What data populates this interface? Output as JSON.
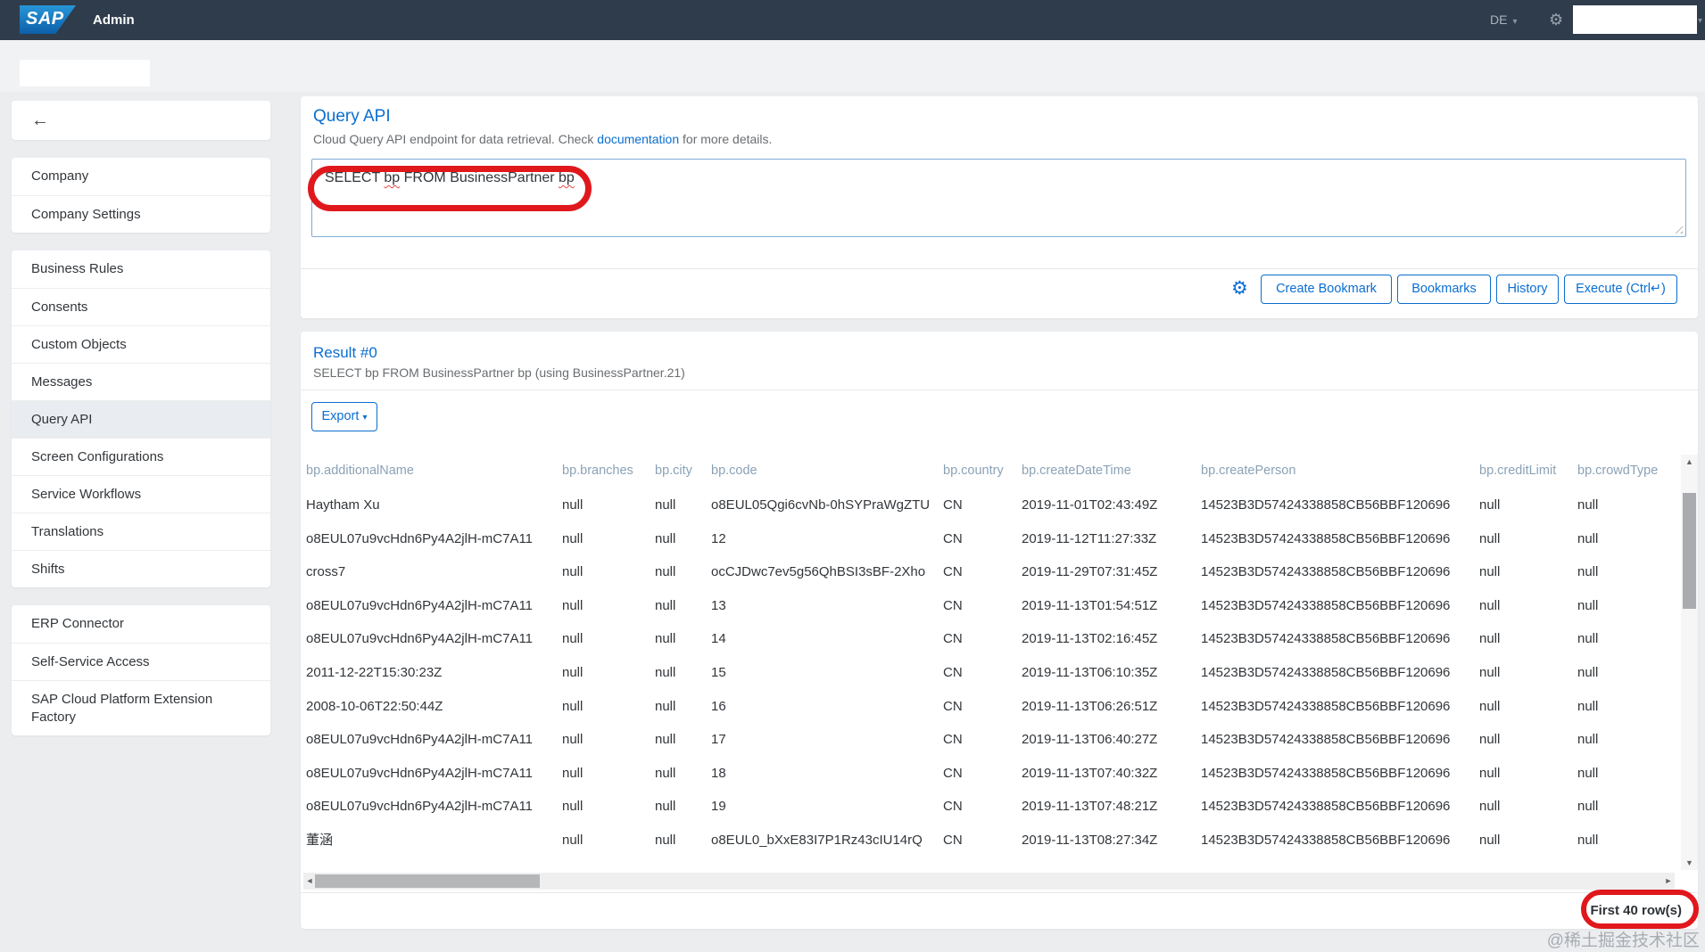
{
  "topbar": {
    "logo_text": "SAP",
    "app_title": "Admin",
    "language": "DE"
  },
  "sidebar": {
    "groups": [
      {
        "items": [
          {
            "label": "Company"
          },
          {
            "label": "Company Settings"
          }
        ]
      },
      {
        "items": [
          {
            "label": "Business Rules"
          },
          {
            "label": "Consents"
          },
          {
            "label": "Custom Objects"
          },
          {
            "label": "Messages"
          },
          {
            "label": "Query API"
          },
          {
            "label": "Screen Configurations"
          },
          {
            "label": "Service Workflows"
          },
          {
            "label": "Translations"
          },
          {
            "label": "Shifts"
          }
        ]
      },
      {
        "items": [
          {
            "label": "ERP Connector"
          },
          {
            "label": "Self-Service Access"
          },
          {
            "label": "SAP Cloud Platform Extension Factory"
          }
        ]
      }
    ]
  },
  "query_panel": {
    "title": "Query API",
    "subtitle_pre": "Cloud Query API endpoint for data retrieval. Check ",
    "subtitle_link": "documentation",
    "subtitle_post": " for more details.",
    "query": {
      "t1": "SELECT ",
      "t2": "bp",
      "t3": " FROM BusinessPartner ",
      "t4": "bp"
    },
    "buttons": {
      "create_bookmark": "Create Bookmark",
      "bookmarks": "Bookmarks",
      "history": "History",
      "execute": "Execute (Ctrl↵)"
    }
  },
  "result_panel": {
    "title": "Result #0",
    "subtitle": "SELECT bp FROM BusinessPartner bp (using BusinessPartner.21)",
    "export_label": "Export",
    "footer": "First 40 row(s)",
    "table": {
      "columns": [
        "bp.additionalName",
        "bp.branches",
        "bp.city",
        "bp.code",
        "bp.country",
        "bp.createDateTime",
        "bp.createPerson",
        "bp.creditLimit",
        "bp.crowdType"
      ],
      "rows": [
        [
          "Haytham Xu",
          "null",
          "null",
          "o8EUL05Qgi6cvNb-0hSYPraWgZTU",
          "CN",
          "2019-11-01T02:43:49Z",
          "14523B3D57424338858CB56BBF120696",
          "null",
          "null"
        ],
        [
          "o8EUL07u9vcHdn6Py4A2jlH-mC7A11",
          "null",
          "null",
          "12",
          "CN",
          "2019-11-12T11:27:33Z",
          "14523B3D57424338858CB56BBF120696",
          "null",
          "null"
        ],
        [
          "cross7",
          "null",
          "null",
          "ocCJDwc7ev5g56QhBSI3sBF-2Xho",
          "CN",
          "2019-11-29T07:31:45Z",
          "14523B3D57424338858CB56BBF120696",
          "null",
          "null"
        ],
        [
          "o8EUL07u9vcHdn6Py4A2jlH-mC7A11",
          "null",
          "null",
          "13",
          "CN",
          "2019-11-13T01:54:51Z",
          "14523B3D57424338858CB56BBF120696",
          "null",
          "null"
        ],
        [
          "o8EUL07u9vcHdn6Py4A2jlH-mC7A11",
          "null",
          "null",
          "14",
          "CN",
          "2019-11-13T02:16:45Z",
          "14523B3D57424338858CB56BBF120696",
          "null",
          "null"
        ],
        [
          "2011-12-22T15:30:23Z",
          "null",
          "null",
          "15",
          "CN",
          "2019-11-13T06:10:35Z",
          "14523B3D57424338858CB56BBF120696",
          "null",
          "null"
        ],
        [
          "2008-10-06T22:50:44Z",
          "null",
          "null",
          "16",
          "CN",
          "2019-11-13T06:26:51Z",
          "14523B3D57424338858CB56BBF120696",
          "null",
          "null"
        ],
        [
          "o8EUL07u9vcHdn6Py4A2jlH-mC7A11",
          "null",
          "null",
          "17",
          "CN",
          "2019-11-13T06:40:27Z",
          "14523B3D57424338858CB56BBF120696",
          "null",
          "null"
        ],
        [
          "o8EUL07u9vcHdn6Py4A2jlH-mC7A11",
          "null",
          "null",
          "18",
          "CN",
          "2019-11-13T07:40:32Z",
          "14523B3D57424338858CB56BBF120696",
          "null",
          "null"
        ],
        [
          "o8EUL07u9vcHdn6Py4A2jlH-mC7A11",
          "null",
          "null",
          "19",
          "CN",
          "2019-11-13T07:48:21Z",
          "14523B3D57424338858CB56BBF120696",
          "null",
          "null"
        ],
        [
          "董涵",
          "null",
          "null",
          "o8EUL0_bXxE83I7P1Rz43cIU14rQ",
          "CN",
          "2019-11-13T08:27:34Z",
          "14523B3D57424338858CB56BBF120696",
          "null",
          "null"
        ]
      ]
    }
  },
  "icons": {
    "back_arrow": "←",
    "gear": "⚙",
    "caret_down": "▾",
    "export_caret": "▾",
    "scroll_up": "▲",
    "scroll_down": "▼",
    "scroll_left": "◄",
    "scroll_right": "►"
  },
  "colors": {
    "accent_blue": "#0a6ed1",
    "topbar": "#2f3c4b",
    "table_header_text": "#8ba2b6",
    "annotation_red": "#e0181c"
  },
  "watermark": "@稀土掘金技术社区"
}
